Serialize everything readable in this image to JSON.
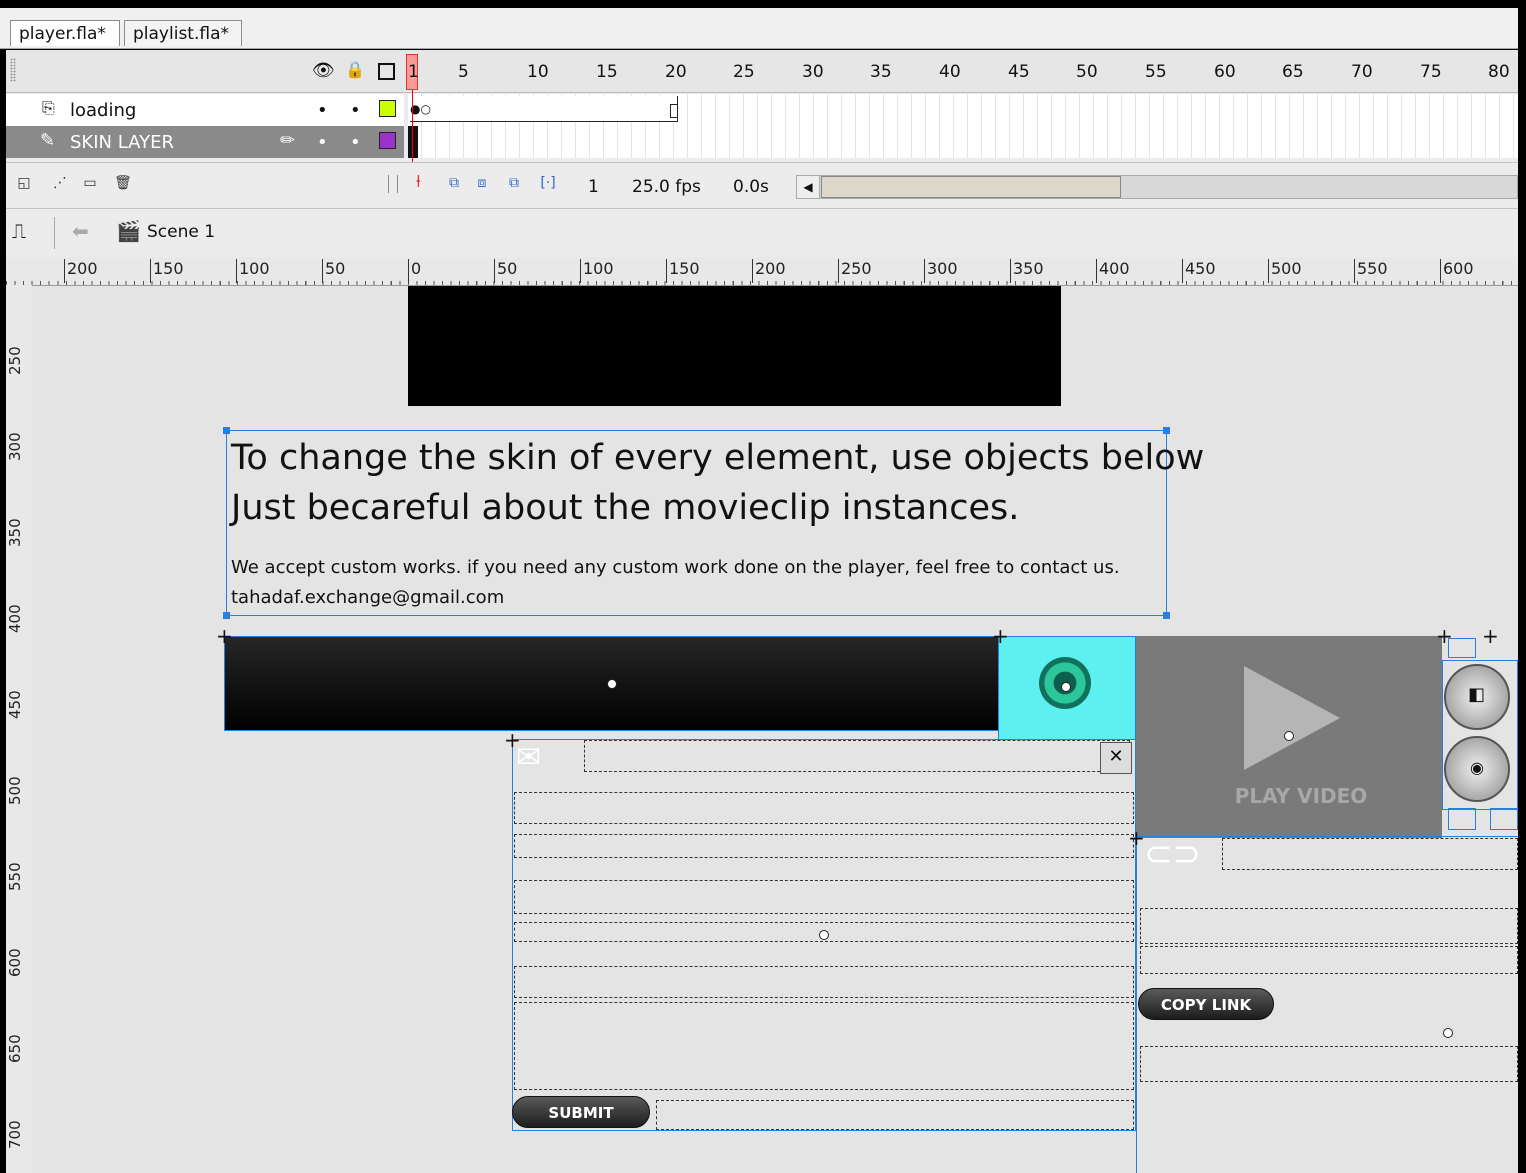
{
  "tabs": [
    {
      "label": "player.fla*",
      "active": true
    },
    {
      "label": "playlist.fla*",
      "active": false
    }
  ],
  "timeline": {
    "frame_numbers": [
      "1",
      "5",
      "10",
      "15",
      "20",
      "25",
      "30",
      "35",
      "40",
      "45",
      "50",
      "55",
      "60",
      "65",
      "70",
      "75",
      "80"
    ],
    "layers": [
      {
        "name": "loading",
        "color": "#ccff00",
        "selected": false
      },
      {
        "name": "SKIN LAYER",
        "color": "#9933cc",
        "selected": true
      }
    ],
    "status": {
      "current_frame": "1",
      "frame_rate": "25.0 fps",
      "elapsed": "0.0s"
    }
  },
  "editbar": {
    "scene": "Scene 1"
  },
  "rulers": {
    "horizontal": [
      "200",
      "150",
      "100",
      "50",
      "0",
      "50",
      "100",
      "150",
      "200",
      "250",
      "300",
      "350",
      "400",
      "450",
      "500",
      "550",
      "600"
    ],
    "vertical": [
      "250",
      "300",
      "350",
      "400",
      "450",
      "500",
      "550",
      "600",
      "650",
      "700"
    ]
  },
  "stage": {
    "heading_line1": "To change the skin of every element, use objects below",
    "heading_line2": "Just becareful about the movieclip instances.",
    "note": "We accept custom works. if you need any custom work done on the player, feel free to contact us.",
    "email": "tahadaf.exchange@gmail.com",
    "play_video_label": "PLAY VIDEO",
    "copy_link_label": "COPY LINK",
    "submit_label": "SUBMIT"
  },
  "colors": {
    "selection": "#2a7de1",
    "cyan_symbol": "#5ef0f0",
    "stage_bg": "#e4e4e4"
  }
}
